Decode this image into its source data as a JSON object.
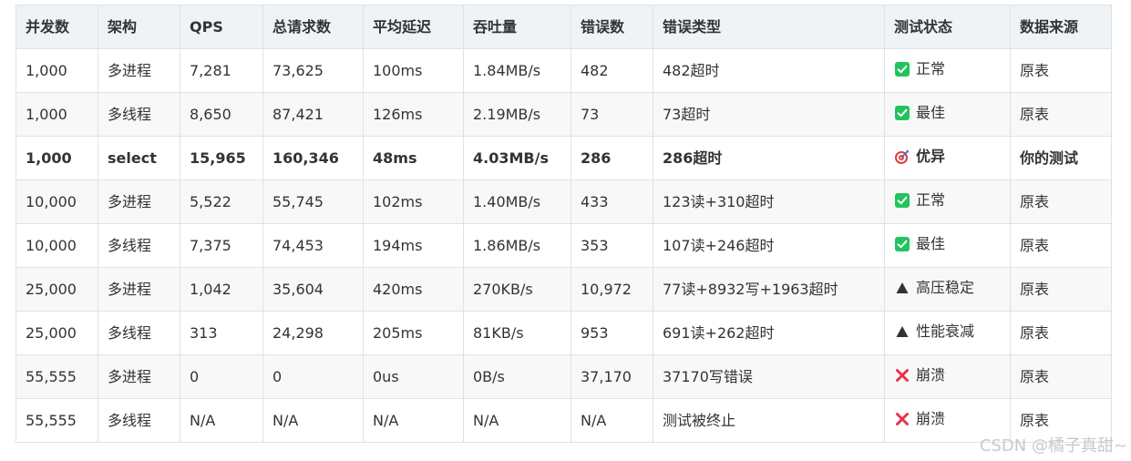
{
  "table": {
    "headers": [
      "并发数",
      "架构",
      "QPS",
      "总请求数",
      "平均延迟",
      "吞吐量",
      "错误数",
      "错误类型",
      "测试状态",
      "数据来源"
    ],
    "rows": [
      {
        "concurrency": "1,000",
        "arch": "多进程",
        "qps": "7,281",
        "total": "73,625",
        "latency": "100ms",
        "throughput": "1.84MB/s",
        "errors": "482",
        "error_type": "482超时",
        "status_icon": "check-icon",
        "status": "正常",
        "source": "原表",
        "bold": false
      },
      {
        "concurrency": "1,000",
        "arch": "多线程",
        "qps": "8,650",
        "total": "87,421",
        "latency": "126ms",
        "throughput": "2.19MB/s",
        "errors": "73",
        "error_type": "73超时",
        "status_icon": "check-icon",
        "status": "最佳",
        "source": "原表",
        "bold": false
      },
      {
        "concurrency": "1,000",
        "arch": "select",
        "qps": "15,965",
        "total": "160,346",
        "latency": "48ms",
        "throughput": "4.03MB/s",
        "errors": "286",
        "error_type": "286超时",
        "status_icon": "target-icon",
        "status": "优异",
        "source": "你的测试",
        "bold": true
      },
      {
        "concurrency": "10,000",
        "arch": "多进程",
        "qps": "5,522",
        "total": "55,745",
        "latency": "102ms",
        "throughput": "1.40MB/s",
        "errors": "433",
        "error_type": "123读+310超时",
        "status_icon": "check-icon",
        "status": "正常",
        "source": "原表",
        "bold": false
      },
      {
        "concurrency": "10,000",
        "arch": "多线程",
        "qps": "7,375",
        "total": "74,453",
        "latency": "194ms",
        "throughput": "1.86MB/s",
        "errors": "353",
        "error_type": "107读+246超时",
        "status_icon": "check-icon",
        "status": "最佳",
        "source": "原表",
        "bold": false
      },
      {
        "concurrency": "25,000",
        "arch": "多进程",
        "qps": "1,042",
        "total": "35,604",
        "latency": "420ms",
        "throughput": "270KB/s",
        "errors": "10,972",
        "error_type": "77读+8932写+1963超时",
        "status_icon": "warning-triangle-icon",
        "status": "高压稳定",
        "source": "原表",
        "bold": false
      },
      {
        "concurrency": "25,000",
        "arch": "多线程",
        "qps": "313",
        "total": "24,298",
        "latency": "205ms",
        "throughput": "81KB/s",
        "errors": "953",
        "error_type": "691读+262超时",
        "status_icon": "warning-triangle-icon",
        "status": "性能衰减",
        "source": "原表",
        "bold": false
      },
      {
        "concurrency": "55,555",
        "arch": "多进程",
        "qps": "0",
        "total": "0",
        "latency": "0us",
        "throughput": "0B/s",
        "errors": "37,170",
        "error_type": "37170写错误",
        "status_icon": "cross-icon",
        "status": "崩溃",
        "source": "原表",
        "bold": false
      },
      {
        "concurrency": "55,555",
        "arch": "多线程",
        "qps": "N/A",
        "total": "N/A",
        "latency": "N/A",
        "throughput": "N/A",
        "errors": "N/A",
        "error_type": "测试被终止",
        "status_icon": "cross-icon",
        "status": "崩溃",
        "source": "原表",
        "bold": false
      }
    ]
  },
  "watermark": "CSDN @橘子真甜~",
  "colors": {
    "header_bg": "#eff3f5",
    "border": "#dfe2e5",
    "stripe": "#f8f8f8",
    "check_green": "#21c45d",
    "cross_red": "#e8324f",
    "target_red": "#e23b3b",
    "text": "#333333"
  }
}
